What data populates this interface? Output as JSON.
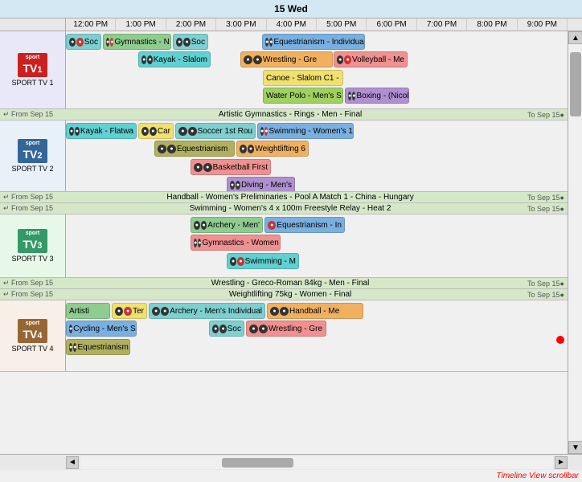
{
  "header": {
    "date": "15 Wed"
  },
  "times": [
    "12:00 PM",
    "1:00 PM",
    "2:00 PM",
    "3:00 PM",
    "4:00 PM",
    "5:00 PM",
    "6:00 PM",
    "7:00 PM",
    "8:00 PM",
    "9:00 PM"
  ],
  "channels": [
    {
      "id": "tv1",
      "logo_sport": "sport",
      "logo_tv": "TV",
      "logo_num": "1",
      "name": "SPORT TV 1",
      "color": "#cc2020"
    },
    {
      "id": "tv2",
      "logo_sport": "sport",
      "logo_tv": "TV",
      "logo_num": "2",
      "name": "SPORT TV 2",
      "color": "#336699"
    },
    {
      "id": "tv3",
      "logo_sport": "sport",
      "logo_tv": "TV",
      "logo_num": "3",
      "name": "SPORT TV 3",
      "color": "#339966"
    },
    {
      "id": "tv4",
      "logo_sport": "sport",
      "logo_tv": "TV",
      "logo_num": "4",
      "name": "SPORT TV 4",
      "color": "#996633"
    }
  ],
  "status_label": "Timeline View scrollbar"
}
